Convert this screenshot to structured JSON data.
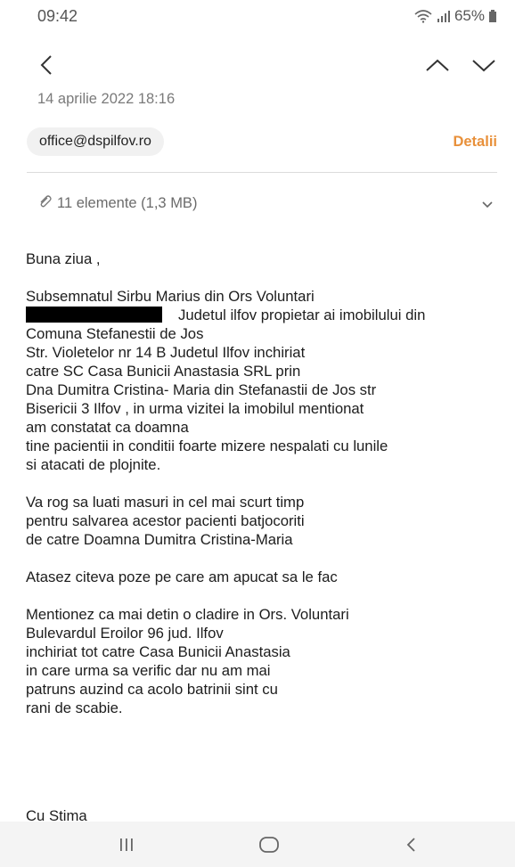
{
  "status_bar": {
    "time": "09:42",
    "battery": "65%"
  },
  "email": {
    "date": "14 aprilie 2022  18:16",
    "sender": "office@dspilfov.ro",
    "details_label": "Detalii",
    "attachments_label": "11 elemente (1,3 MB)",
    "greeting": "Buna ziua ,",
    "paragraph1_lines": [
      "Subsemnatul Sirbu Marius din Ors Voluntari",
      "Judetul ilfov propietar ai imobilului din",
      "Comuna Stefanestii de Jos",
      "Str. Violetelor nr 14 B Judetul Ilfov inchiriat",
      "catre SC Casa Bunicii Anastasia SRL prin",
      "Dna Dumitra Cristina- Maria din Stefanastii de Jos str",
      "Bisericii 3 Ilfov ,  in urma vizitei la imobilul mentionat",
      "am constatat ca doamna",
      "tine pacientii in conditii foarte mizere nespalati cu lunile",
      "si atacati de plojnite."
    ],
    "paragraph2_lines": [
      "Va rog sa luati masuri in cel mai scurt timp",
      "pentru salvarea acestor pacienti batjocoriti",
      "de catre Doamna Dumitra Cristina-Maria"
    ],
    "paragraph3_lines": [
      "Atasez citeva poze pe care am apucat sa le fac"
    ],
    "paragraph4_lines": [
      "Mentionez ca mai detin o cladire in Ors. Voluntari",
      "Bulevardul Eroilor 96 jud. Ilfov",
      "inchiriat tot catre Casa Bunicii Anastasia",
      "in care urma sa verific dar nu am mai",
      "patruns auzind ca acolo batrinii sint cu",
      "rani de scabie."
    ],
    "signoff": "Cu Stima"
  },
  "icons": {
    "back": "back-arrow-icon",
    "prev": "chevron-up-icon",
    "next": "chevron-down-icon",
    "attachment": "paperclip-icon",
    "expand": "chevron-down-icon",
    "recents": "recents-icon",
    "home": "home-icon",
    "nav_back": "nav-back-icon"
  },
  "colors": {
    "accent": "#e8903a",
    "chip_bg": "#f1f1f1",
    "secondary_text": "#7a7a7a"
  }
}
